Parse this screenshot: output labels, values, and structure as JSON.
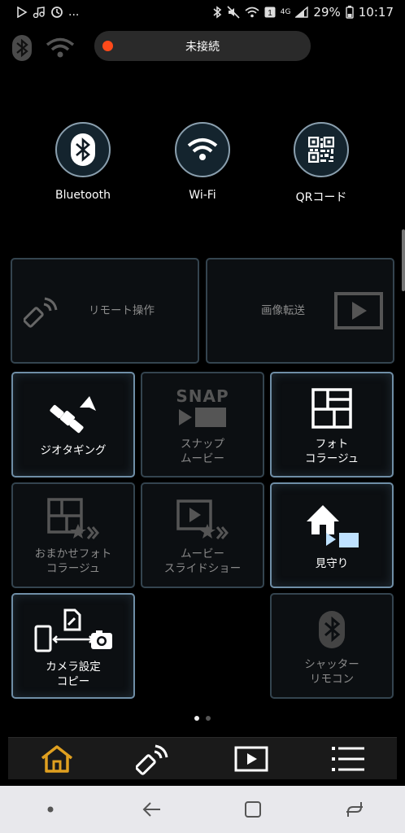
{
  "status_bar": {
    "icons_left": [
      "play-store-icon",
      "music-icon",
      "sync-icon"
    ],
    "more": "...",
    "icons_right": [
      "bluetooth-icon",
      "mute-icon",
      "wifi-icon",
      "notification-1-icon",
      "signal-4g-icon"
    ],
    "network_label": "4G",
    "battery": "29%",
    "time": "10:17"
  },
  "connection": {
    "status": "未接続",
    "status_color": "#ff4a1a"
  },
  "connect_options": [
    {
      "label": "Bluetooth",
      "icon": "bluetooth-icon"
    },
    {
      "label": "Wi-Fi",
      "icon": "wifi-icon"
    },
    {
      "label": "QRコード",
      "icon": "qr-code-icon"
    }
  ],
  "tiles": {
    "remote": {
      "label": "リモート操作",
      "icon": "remote-icon",
      "enabled": false
    },
    "transfer": {
      "label": "画像転送",
      "icon": "play-screen-icon",
      "enabled": false
    },
    "geotagging": {
      "label": "ジオタギング",
      "icon": "satellite-icon",
      "enabled": true
    },
    "snap_movie": {
      "label": "スナップ\nムービー",
      "icon": "snap-movie-icon",
      "icon_text": "SNAP",
      "enabled": false
    },
    "photo_collage": {
      "label": "フォト\nコラージュ",
      "icon": "collage-grid-icon",
      "enabled": true
    },
    "auto_collage": {
      "label": "おまかせフォト\nコラージュ",
      "icon": "auto-collage-icon",
      "enabled": false
    },
    "movie_slideshow": {
      "label": "ムービー\nスライドショー",
      "icon": "slideshow-icon",
      "enabled": false
    },
    "home_monitor": {
      "label": "見守り",
      "icon": "home-camera-icon",
      "enabled": true
    },
    "copy_settings": {
      "label": "カメラ設定\nコピー",
      "icon": "copy-settings-icon",
      "enabled": true
    },
    "shutter_remote": {
      "label": "シャッター\nリモコン",
      "icon": "bluetooth-icon",
      "enabled": false
    }
  },
  "pager": {
    "pages": 2,
    "current": 1
  },
  "tab_bar": [
    {
      "name": "home",
      "icon": "home-icon",
      "active": true,
      "color": "#e0a020"
    },
    {
      "name": "remote",
      "icon": "remote-icon",
      "active": false
    },
    {
      "name": "playback",
      "icon": "play-icon",
      "active": false
    },
    {
      "name": "menu",
      "icon": "menu-icon",
      "active": false
    }
  ],
  "nav_bar": [
    "recent-dot-icon",
    "back-icon",
    "home-square-icon",
    "recents-icon"
  ]
}
